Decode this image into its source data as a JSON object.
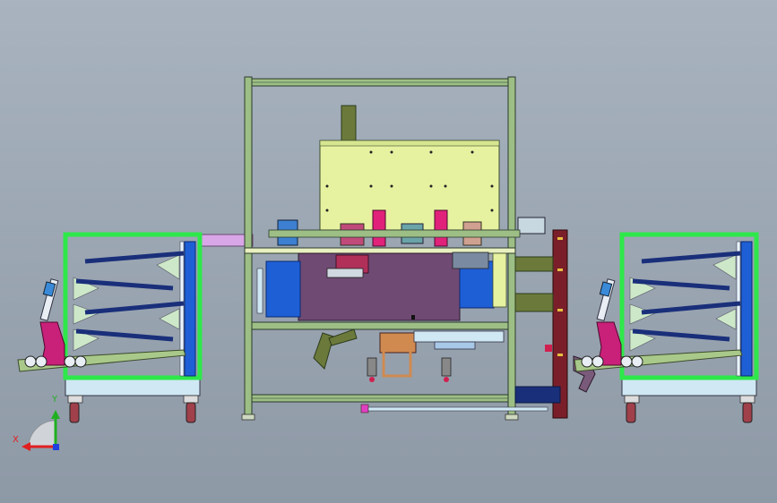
{
  "viewport": {
    "background_top": "#a8b3bf",
    "background_bottom": "#8e99a6"
  },
  "colors": {
    "frame_green": "#9dbf86",
    "frame_outline": "#2b3a2b",
    "panel_yellow": "#e6f2a0",
    "body_purple": "#6f4a73",
    "blue_block": "#1f5fd6",
    "navy": "#1a2f7a",
    "cart_green": "#2ee84a",
    "cart_blue": "#1f5fd6",
    "cart_base": "#cfe8f4",
    "magenta": "#e0227a",
    "maroon": "#7a1f2a",
    "olive_arm": "#6b7a3a",
    "pink_plate": "#d9a6e8"
  },
  "triad": {
    "x_label": "X",
    "y_label": "Y",
    "x_color": "#e02020",
    "y_color": "#20b020",
    "z_color": "#2040e0"
  }
}
